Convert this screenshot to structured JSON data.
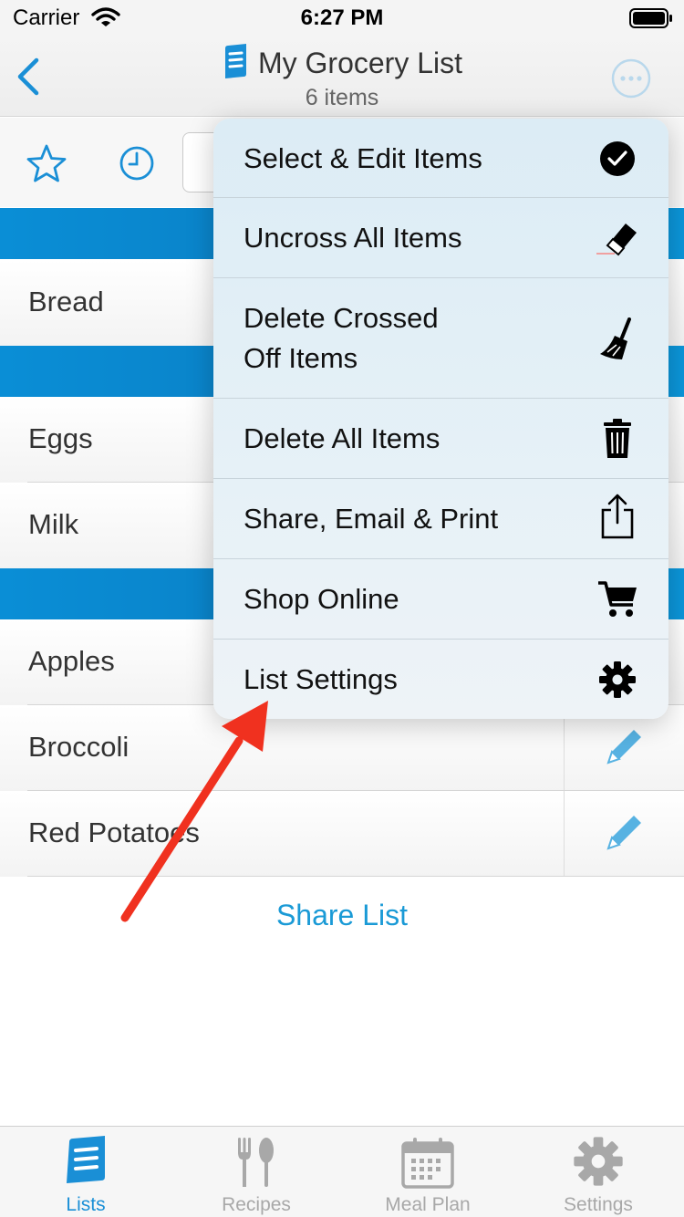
{
  "status_bar": {
    "carrier": "Carrier",
    "time": "6:27 PM"
  },
  "nav": {
    "title": "My Grocery List",
    "subtitle": "6 items"
  },
  "list": {
    "items": [
      {
        "name": "Bread"
      },
      {
        "name": "Eggs"
      },
      {
        "name": "Milk"
      },
      {
        "name": "Apples"
      },
      {
        "name": "Broccoli"
      },
      {
        "name": "Red Potatoes"
      }
    ],
    "share_label": "Share List"
  },
  "menu": {
    "items": [
      {
        "label": "Select & Edit Items",
        "icon": "checkmark-circle-icon"
      },
      {
        "label": "Uncross All Items",
        "icon": "eraser-icon"
      },
      {
        "label": "Delete Crossed\nOff Items",
        "icon": "broom-icon"
      },
      {
        "label": "Delete All Items",
        "icon": "trash-icon"
      },
      {
        "label": "Share, Email & Print",
        "icon": "share-icon"
      },
      {
        "label": "Shop Online",
        "icon": "cart-icon"
      },
      {
        "label": "List Settings",
        "icon": "gear-icon"
      }
    ]
  },
  "tabs": [
    {
      "label": "Lists",
      "icon": "list-icon",
      "active": true
    },
    {
      "label": "Recipes",
      "icon": "fork-spoon-icon",
      "active": false
    },
    {
      "label": "Meal Plan",
      "icon": "calendar-icon",
      "active": false
    },
    {
      "label": "Settings",
      "icon": "gear-icon",
      "active": false
    }
  ],
  "colors": {
    "accent": "#1a8fd6",
    "section": "#0a8ed6",
    "arrow": "#f0311f"
  }
}
